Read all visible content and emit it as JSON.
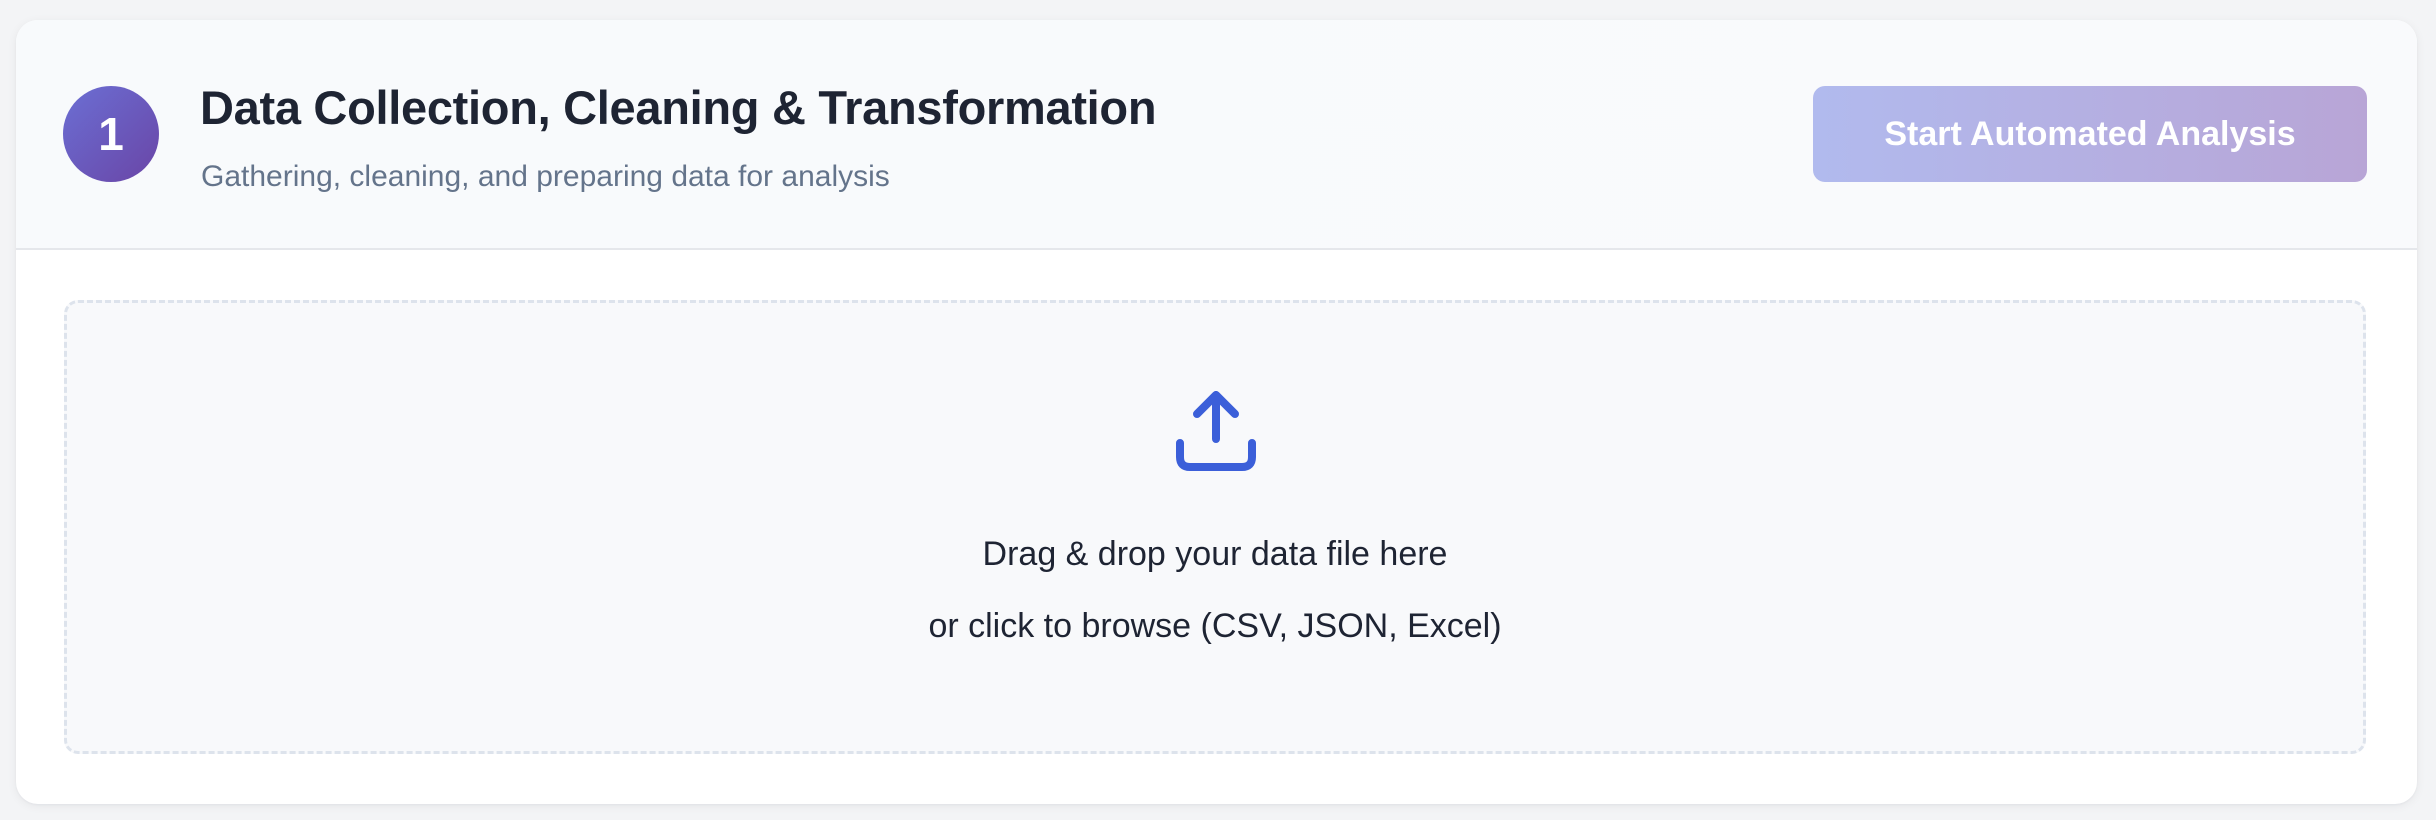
{
  "step": {
    "number": "1",
    "title": "Data Collection, Cleaning & Transformation",
    "subtitle": "Gathering, cleaning, and preparing data for analysis"
  },
  "actions": {
    "start_label": "Start Automated Analysis",
    "start_enabled": false
  },
  "dropzone": {
    "icon": "upload-icon",
    "main_text": "Drag & drop your data file here",
    "sub_text": "or click to browse (CSV, JSON, Excel)"
  },
  "colors": {
    "accent": "#3b5fd9",
    "badge_start": "#6b6fd4",
    "badge_end": "#6a45a6",
    "button_start": "#b1baee",
    "button_end": "#b8a5d6"
  }
}
